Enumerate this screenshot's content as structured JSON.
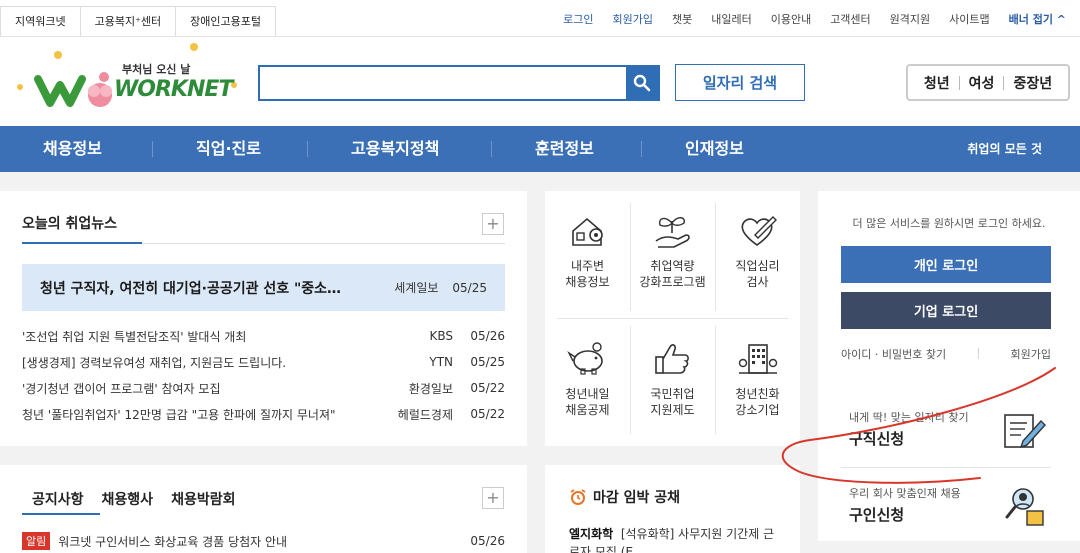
{
  "topbar": {
    "family_tabs": [
      "지역워크넷",
      "고용복지⁺센터",
      "장애인고용포털"
    ],
    "links": [
      "로그인",
      "회원가입",
      "챗봇",
      "내일레터",
      "이용안내",
      "고객센터",
      "원격지원",
      "사이트맵"
    ],
    "banner_toggle": "배너 접기 ^"
  },
  "header": {
    "logo_slogan": "부처님 오신 날",
    "logo_text": "WORKNET",
    "search_placeholder": "",
    "job_search_label": "일자리 검색",
    "target_groups": [
      "청년",
      "여성",
      "중장년"
    ]
  },
  "gnb": {
    "items": [
      "채용정보",
      "직업·진로",
      "고용복지정책",
      "훈련정보",
      "인재정보"
    ],
    "all_label": "취업의 모든 것"
  },
  "news": {
    "title": "오늘의 취업뉴스",
    "headline": {
      "text": "청년 구직자, 여전히 대기업·공공기관 선호 \"중소…",
      "source": "세계일보",
      "date": "05/25"
    },
    "items": [
      {
        "text": "'조선업 취업 지원 특별전담조직' 발대식 개최",
        "source": "KBS",
        "date": "05/26"
      },
      {
        "text": "[생생경제] 경력보유여성 재취업, 지원금도 드립니다.",
        "source": "YTN",
        "date": "05/25"
      },
      {
        "text": "'경기청년 갭이어 프로그램' 참여자 모집",
        "source": "환경일보",
        "date": "05/22"
      },
      {
        "text": "청년 '풀타임취업자' 12만명 급감 \"고용 한파에 질까지 무너져\"",
        "source": "헤럴드경제",
        "date": "05/22"
      }
    ]
  },
  "notice": {
    "tabs": [
      "공지사항",
      "채용행사",
      "채용박람회"
    ],
    "items": [
      {
        "badge": "알림",
        "text": "워크넷 구인서비스 화상교육 경품 당첨자 안내",
        "date": "05/26"
      }
    ]
  },
  "quick_icons": [
    {
      "name": "home-map",
      "label": "내주변\n채용정보"
    },
    {
      "name": "plant-hand",
      "label": "취업역량\n강화프로그램"
    },
    {
      "name": "heart-pen",
      "label": "직업심리\n검사"
    },
    {
      "name": "piggy-bank",
      "label": "청년내일\n채움공제"
    },
    {
      "name": "thumbs-up",
      "label": "국민취업\n지원제도"
    },
    {
      "name": "building",
      "label": "청년친화\n강소기업"
    }
  ],
  "deadline": {
    "title": "마감 임박 공채",
    "item_company": "엘지화학",
    "item_text": "[석유화학] 사무지원 기간제 근로자 모집 (E…"
  },
  "login": {
    "message": "더 많은 서비스를 원하시면 로그인 하세요.",
    "personal": "개인 로그인",
    "company": "기업 로그인",
    "find_id": "아이디 · 비밀번호 찾기",
    "join": "회원가입",
    "services": [
      {
        "sub": "내게 딱! 맞는 일자리 찾기",
        "main": "구직신청"
      },
      {
        "sub": "우리 회사 맞춤인재 채용",
        "main": "구인신청"
      }
    ]
  },
  "colors": {
    "brand_blue": "#3b6fb6",
    "dark_navy": "#3c4a66",
    "headline_bg": "#dbe8f7",
    "alert_red": "#d9362b"
  }
}
